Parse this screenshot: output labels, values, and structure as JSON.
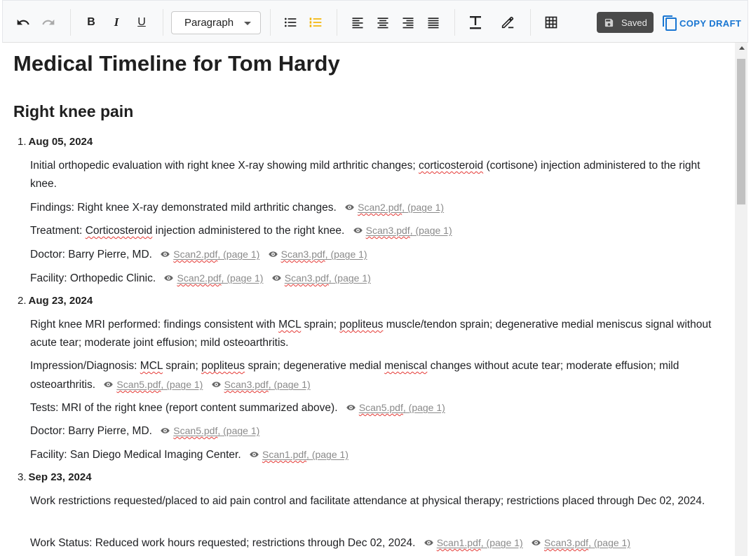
{
  "toolbar": {
    "paragraph_select": "Paragraph",
    "bold": "B",
    "italic": "I",
    "underline": "U",
    "saved_label": "Saved",
    "copy_label": "COPY DRAFT"
  },
  "document": {
    "title": "Medical Timeline for Tom Hardy",
    "section": "Right knee pain",
    "entries": [
      {
        "number": "1.",
        "date": "Aug 05, 2024",
        "summary": {
          "before": "Initial orthopedic evaluation with right knee X-ray showing mild arthritic changes; ",
          "word": "corticosteroid",
          "after": " (cortisone) injection administered to the right knee."
        },
        "findings": {
          "text": "Findings: Right knee X-ray demonstrated mild arthritic changes.",
          "refs": [
            {
              "file": "Scan2.pdf",
              "page": ", (page 1)"
            }
          ]
        },
        "treatment": {
          "prefix": "Treatment: ",
          "word": "Corticosteroid",
          "suffix": " injection administered to the right knee.",
          "refs": [
            {
              "file": "Scan3.pdf",
              "page": ", (page 1)"
            }
          ]
        },
        "doctor": {
          "text": "Doctor: Barry Pierre, MD.",
          "refs": [
            {
              "file": "Scan2.pdf",
              "page": ", (page 1)"
            },
            {
              "file": "Scan3.pdf",
              "page": ", (page 1)"
            }
          ]
        },
        "facility": {
          "text": "Facility: Orthopedic Clinic.",
          "refs": [
            {
              "file": "Scan2.pdf",
              "page": ", (page 1)"
            },
            {
              "file": "Scan3.pdf",
              "page": ", (page 1)"
            }
          ]
        }
      },
      {
        "number": "2.",
        "date": "Aug 23, 2024",
        "summary": {
          "p1": "Right knee MRI performed: findings consistent with ",
          "w1": "MCL",
          "p2": " sprain; ",
          "w2": "popliteus",
          "p3": " muscle/tendon sprain; degenerative medial meniscus signal without acute tear; moderate joint effusion; mild osteoarthritis."
        },
        "impression": {
          "p1": "Impression/Diagnosis: ",
          "w1": "MCL",
          "p2": " sprain; ",
          "w2": "popliteus",
          "p3": " sprain; degenerative medial ",
          "w3": "meniscal",
          "p4": " changes without acute tear; moderate effusion; mild osteoarthritis.",
          "refs": [
            {
              "file": "Scan5.pdf",
              "page": ", (page 1)"
            },
            {
              "file": "Scan3.pdf",
              "page": ", (page 1)"
            }
          ]
        },
        "tests": {
          "text": "Tests: MRI of the right knee (report content summarized above).",
          "refs": [
            {
              "file": "Scan5.pdf",
              "page": ", (page 1)"
            }
          ]
        },
        "doctor": {
          "text": "Doctor: Barry Pierre, MD.",
          "refs": [
            {
              "file": "Scan5.pdf",
              "page": ", (page 1)"
            }
          ]
        },
        "facility": {
          "text": "Facility: San Diego Medical Imaging Center.",
          "refs": [
            {
              "file": "Scan1.pdf",
              "page": ", (page 1)"
            }
          ]
        }
      },
      {
        "number": "3.",
        "date": "Sep 23, 2024",
        "summary": {
          "text": "Work restrictions requested/placed to aid pain control and facilitate attendance at physical therapy; restrictions placed through Dec 02, 2024."
        },
        "work_status": {
          "text": "Work Status: Reduced work hours requested; restrictions through Dec 02, 2024.",
          "refs": [
            {
              "file": "Scan1.pdf",
              "page": ", (page 1)"
            },
            {
              "file": "Scan3.pdf",
              "page": ", (page 1)"
            }
          ]
        }
      }
    ]
  }
}
